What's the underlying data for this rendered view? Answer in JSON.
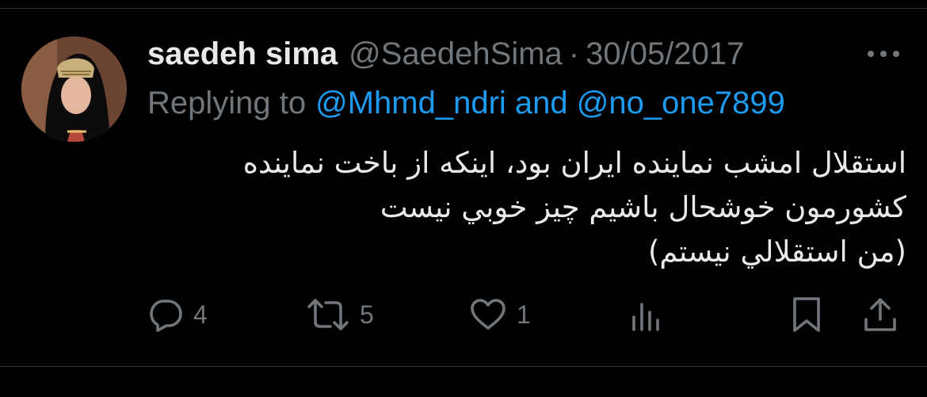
{
  "tweet": {
    "display_name": "saedeh sima",
    "handle": "@SaedehSima",
    "separator": "·",
    "date": "30/05/2017",
    "replying_prefix": "Replying to",
    "replying_users": "@Mhmd_ndri and @no_one7899",
    "body_lines": [
      "استقلال امشب نماینده ایران بود، اینکه از باخت نماینده",
      "کشورمون خوشحال باشیم چیز خوبي نیست",
      "(من استقلالي نیستم)"
    ],
    "actions": {
      "replies": "4",
      "retweets": "5",
      "likes": "1"
    }
  },
  "colors": {
    "background": "#000000",
    "text": "#e7e9ea",
    "muted": "#71767b",
    "link": "#1d9bf0",
    "divider": "#2f3336"
  },
  "icons": [
    "more-icon",
    "reply-icon",
    "retweet-icon",
    "like-icon",
    "views-icon",
    "bookmark-icon",
    "share-icon"
  ]
}
